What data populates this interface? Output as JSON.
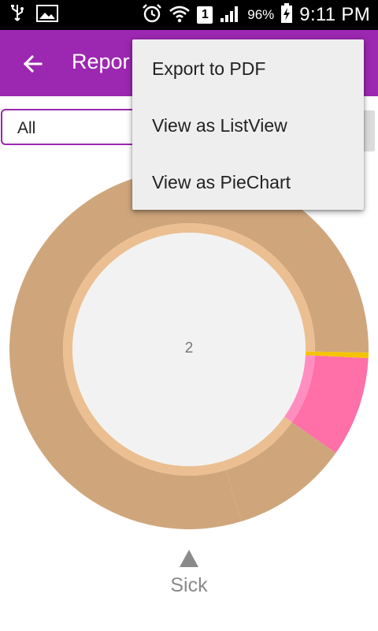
{
  "status_bar": {
    "battery_percent": "96%",
    "time": "9:11 PM",
    "sim_slot": "1",
    "icons": [
      "usb-icon",
      "image-icon",
      "alarm-icon",
      "wifi-icon",
      "signal-icon",
      "battery-charging-icon"
    ]
  },
  "app_bar": {
    "title": "Repor",
    "back_icon": "arrow-left-icon",
    "color": "#9c27b0"
  },
  "filter": {
    "selected": "All"
  },
  "chart_data": {
    "type": "pie",
    "style": "donut",
    "center_label": "2",
    "slices": [
      {
        "label": "",
        "value": 0.8,
        "color": "#cfa67c",
        "inner_color": "#ebbf92"
      },
      {
        "label": "",
        "value": 0.005,
        "color": "#f5c400",
        "inner_color": "#f5c400"
      },
      {
        "label": "Sick",
        "value": 0.09,
        "color": "#ff6fa8",
        "inner_color": "#ff8ec0"
      },
      {
        "label": "",
        "value": 0.105,
        "color": "#cfa67c",
        "inner_color": "#ebbf92"
      }
    ],
    "legend": [
      {
        "label": "Sick",
        "marker": "triangle-up",
        "color": "#8a8a8a"
      }
    ]
  },
  "overflow_menu": {
    "items": [
      {
        "label": "Export to PDF"
      },
      {
        "label": "View as ListView"
      },
      {
        "label": "View as PieChart"
      }
    ]
  }
}
